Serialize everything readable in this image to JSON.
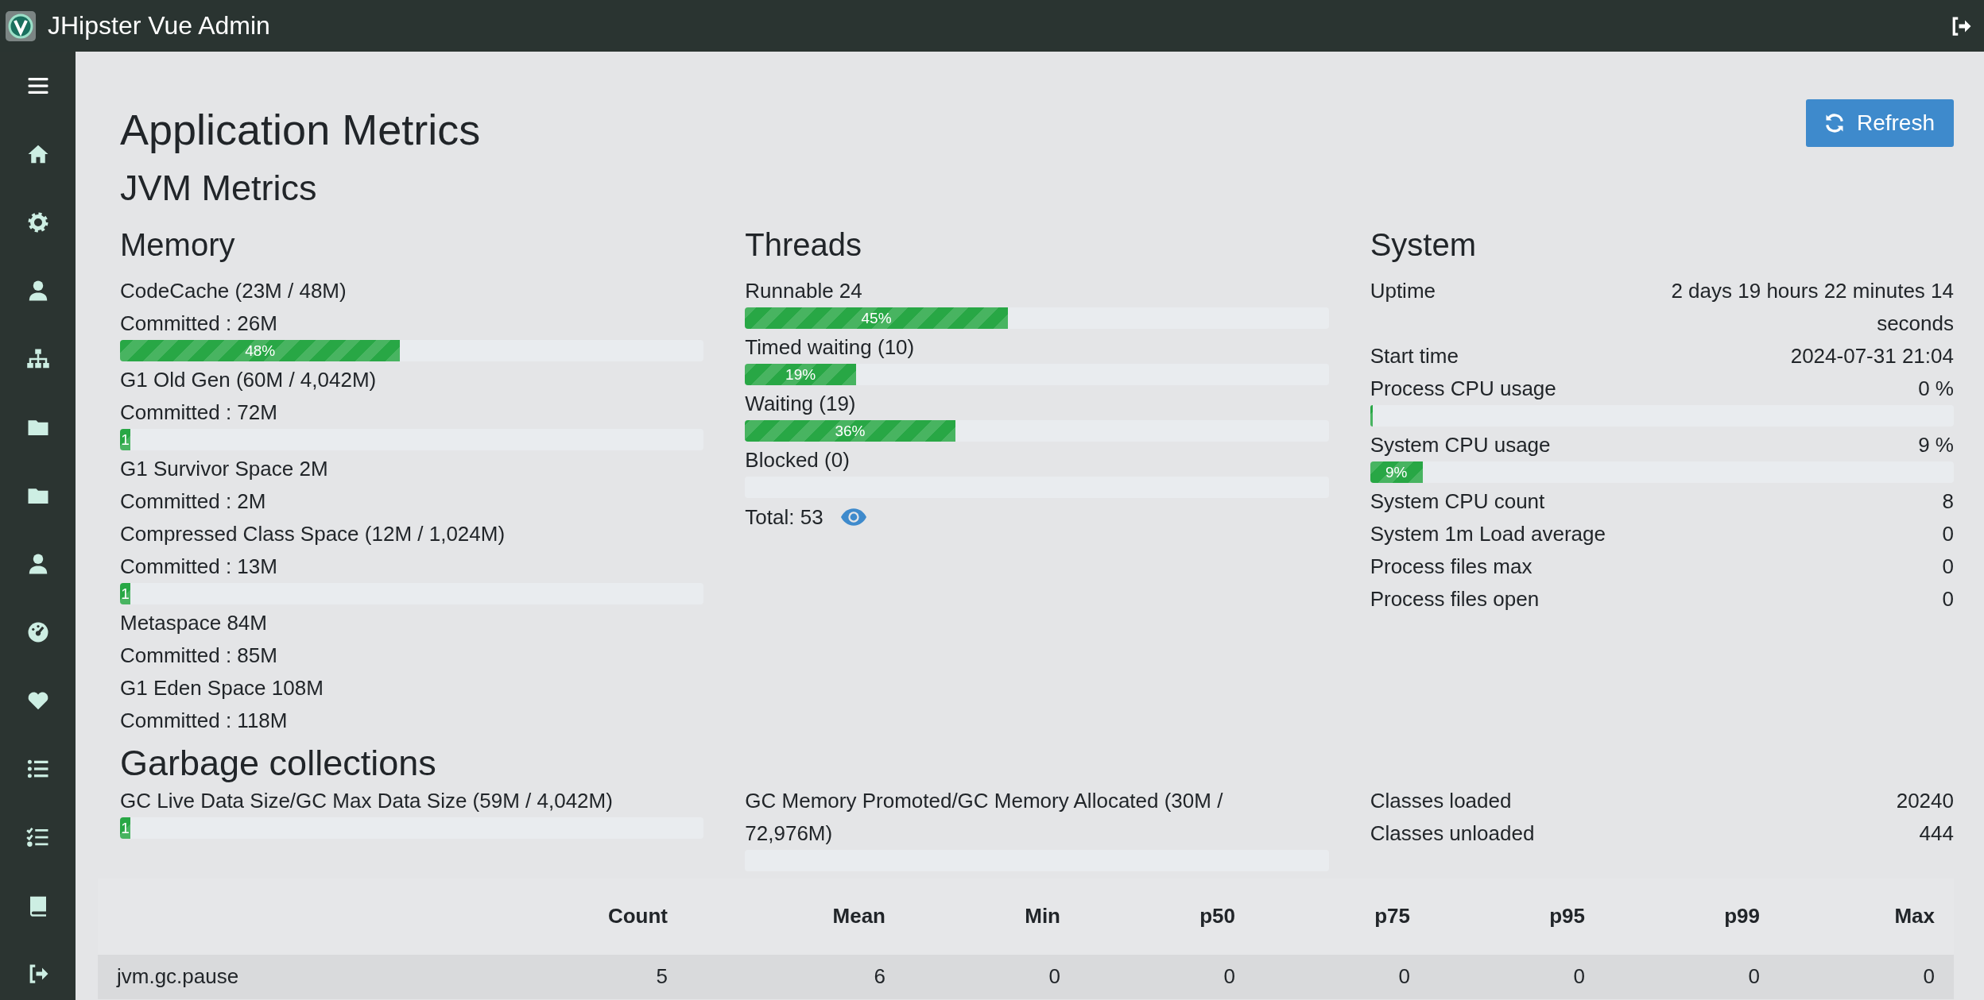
{
  "app": {
    "title": "JHipster Vue Admin"
  },
  "page": {
    "title": "Application Metrics",
    "refresh_button": "Refresh",
    "jvm_title": "JVM Metrics"
  },
  "memory": {
    "title": "Memory",
    "items": [
      {
        "name": "CodeCache (23M / 48M)",
        "committed": "Committed : 26M",
        "bar": {
          "level": 0.48,
          "label": "48%"
        }
      },
      {
        "name": "G1 Old Gen (60M / 4,042M)",
        "committed": "Committed : 72M",
        "bar": {
          "level": 0.01,
          "label": "1"
        }
      },
      {
        "name": "G1 Survivor Space 2M",
        "committed": "Committed : 2M"
      },
      {
        "name": "Compressed Class Space (12M / 1,024M)",
        "committed": "Committed : 13M",
        "bar": {
          "level": 0.01,
          "label": "1"
        }
      },
      {
        "name": "Metaspace 84M",
        "committed": "Committed : 85M"
      },
      {
        "name": "G1 Eden Space 108M",
        "committed": "Committed : 118M"
      }
    ]
  },
  "threads": {
    "title": "Threads",
    "items": [
      {
        "label": "Runnable 24",
        "level": 0.45,
        "bar_label": "45%"
      },
      {
        "label": "Timed waiting (10)",
        "level": 0.19,
        "bar_label": "19%"
      },
      {
        "label": "Waiting (19)",
        "level": 0.36,
        "bar_label": "36%"
      },
      {
        "label": "Blocked (0)"
      }
    ],
    "total": "Total: 53"
  },
  "system": {
    "title": "System",
    "rows": [
      {
        "kind": "value",
        "label": "Uptime",
        "value": "2 days 19 hours 22 minutes 14 seconds"
      },
      {
        "kind": "value",
        "label": "Start time",
        "value": "2024-07-31 21:04"
      },
      {
        "kind": "meter",
        "label": "Process CPU usage",
        "value": "0 %",
        "level": 0
      },
      {
        "kind": "meter",
        "label": "System CPU usage",
        "value": "9 %",
        "level": 0.09,
        "bar_label": "9%"
      },
      {
        "kind": "value",
        "label": "System CPU count",
        "value": "8"
      },
      {
        "kind": "value",
        "label": "System 1m Load average",
        "value": "0"
      },
      {
        "kind": "value",
        "label": "Process files max",
        "value": "0"
      },
      {
        "kind": "value",
        "label": "Process files open",
        "value": "0"
      }
    ]
  },
  "garbage_collections": {
    "title": "Garbage collections",
    "live_data": {
      "label": "GC Live Data Size/GC Max Data Size (59M / 4,042M)",
      "level": 0.01,
      "bar_label": "1"
    },
    "memory_promoted": {
      "label": "GC Memory Promoted/GC Memory Allocated (30M / 72,976M)"
    },
    "classes": [
      {
        "label": "Classes loaded",
        "value": "20240"
      },
      {
        "label": "Classes unloaded",
        "value": "444"
      }
    ]
  },
  "table": {
    "columns": [
      "Count",
      "Mean",
      "Min",
      "p50",
      "p75",
      "p95",
      "p99",
      "Max"
    ],
    "rows": [
      {
        "name": "jvm.gc.pause",
        "values": [
          "5",
          "6",
          "0",
          "0",
          "0",
          "0",
          "0",
          "0"
        ]
      }
    ]
  }
}
